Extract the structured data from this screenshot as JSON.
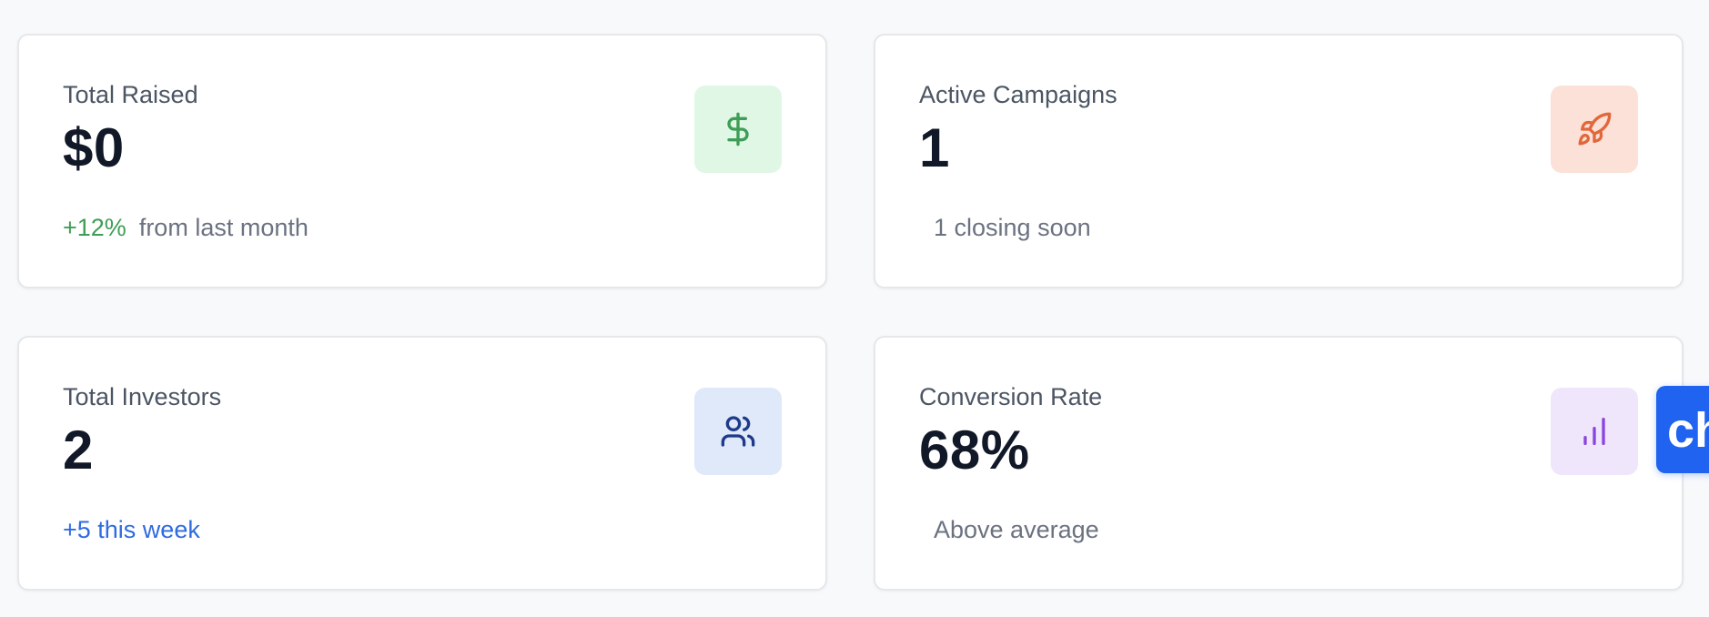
{
  "cards": [
    {
      "label": "Total Raised",
      "value": "$0",
      "delta": "+12%",
      "note": "from last month",
      "icon": "dollar-icon",
      "icon_color": "#3f9d55",
      "icon_bg": "#e0f7e6"
    },
    {
      "label": "Active Campaigns",
      "value": "1",
      "note": "1 closing soon",
      "icon": "rocket-icon",
      "icon_color": "#e2673a",
      "icon_bg": "#fbe1d7"
    },
    {
      "label": "Total Investors",
      "value": "2",
      "note": "+5 this week",
      "icon": "users-icon",
      "icon_color": "#1e3a8a",
      "icon_bg": "#dfe9f9"
    },
    {
      "label": "Conversion Rate",
      "value": "68%",
      "note": "Above average",
      "icon": "bar-chart-icon",
      "icon_color": "#8b44e0",
      "icon_bg": "#efe6fb"
    }
  ],
  "chat_widget": {
    "label": "ch"
  }
}
